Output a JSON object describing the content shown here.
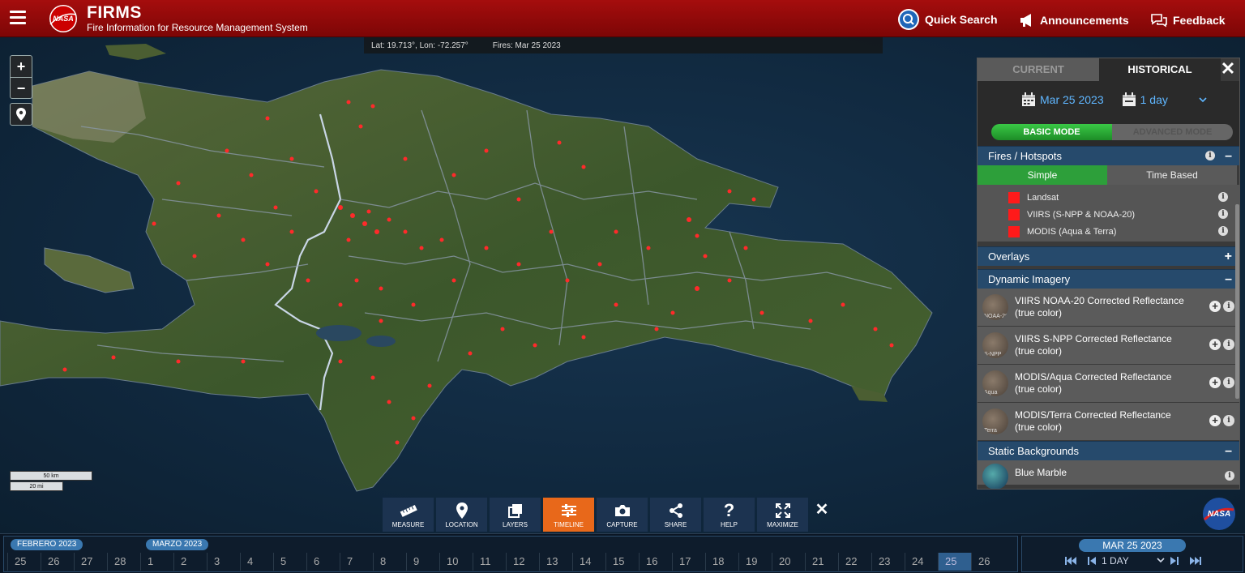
{
  "header": {
    "logo_text": "NASA",
    "title": "FIRMS",
    "subtitle": "Fire Information for Resource Management System",
    "quick_search": "Quick Search",
    "announcements": "Announcements",
    "feedback": "Feedback"
  },
  "coords": {
    "latlon": "Lat: 19.713°, Lon: -72.257°",
    "fires": "Fires: Mar 25 2023"
  },
  "map_controls": {
    "zoom_in": "+",
    "zoom_out": "−"
  },
  "scale": {
    "km": "50 km",
    "mi": "20 mi"
  },
  "panel": {
    "tab_current": "CURRENT",
    "tab_historical": "HISTORICAL",
    "date": "Mar 25 2023",
    "range": "1 day",
    "mode_basic": "BASIC MODE",
    "mode_advanced": "ADVANCED MODE",
    "fires_title": "Fires / Hotspots",
    "fires_toggle": "–",
    "subtab_simple": "Simple",
    "subtab_time": "Time Based",
    "fire_layers": [
      {
        "label": "Landsat",
        "color": "#ff1a1a"
      },
      {
        "label": "VIIRS (S-NPP & NOAA-20)",
        "color": "#ff1a1a"
      },
      {
        "label": "MODIS (Aqua & Terra)",
        "color": "#ff1a1a"
      }
    ],
    "overlays_title": "Overlays",
    "overlays_toggle": "+",
    "dynamic_title": "Dynamic Imagery",
    "dynamic_toggle": "–",
    "imagery": [
      {
        "label": "VIIRS NOAA-20 Corrected Reflectance (true color)",
        "thumb": "NOAA-20"
      },
      {
        "label": "VIIRS S-NPP Corrected Reflectance (true color)",
        "thumb": "S-NPP"
      },
      {
        "label": "MODIS/Aqua Corrected Reflectance (true color)",
        "thumb": "Aqua"
      },
      {
        "label": "MODIS/Terra Corrected Reflectance (true color)",
        "thumb": "Terra"
      }
    ],
    "static_title": "Static Backgrounds",
    "static_toggle": "–",
    "blue_marble": "Blue Marble"
  },
  "toolbar": {
    "tools": [
      {
        "label": "MEASURE",
        "icon": "ruler-icon",
        "active": false
      },
      {
        "label": "LOCATION",
        "icon": "location-pin-icon",
        "active": false
      },
      {
        "label": "LAYERS",
        "icon": "layers-icon",
        "active": false
      },
      {
        "label": "TIMELINE",
        "icon": "timeline-icon",
        "active": true
      },
      {
        "label": "CAPTURE",
        "icon": "camera-icon",
        "active": false
      },
      {
        "label": "SHARE",
        "icon": "share-icon",
        "active": false
      },
      {
        "label": "HELP",
        "icon": "help-icon",
        "active": false
      },
      {
        "label": "MAXIMIZE",
        "icon": "maximize-icon",
        "active": false
      }
    ]
  },
  "timeline": {
    "month1": "FEBRERO 2023",
    "month2": "MARZO 2023",
    "days": [
      "25",
      "26",
      "27",
      "28",
      "1",
      "2",
      "3",
      "4",
      "5",
      "6",
      "7",
      "8",
      "9",
      "10",
      "11",
      "12",
      "13",
      "14",
      "15",
      "16",
      "17",
      "18",
      "19",
      "20",
      "21",
      "22",
      "23",
      "24",
      "25",
      "26"
    ],
    "selected_index": 28,
    "current_date": "MAR 25 2023",
    "step": "1 DAY"
  },
  "colors": {
    "header_red": "#a50d0d",
    "accent_blue": "#5fb6ff",
    "active_orange": "#e8681a",
    "mode_green": "#2d9f3a",
    "fire_red": "#ff1a1a"
  }
}
